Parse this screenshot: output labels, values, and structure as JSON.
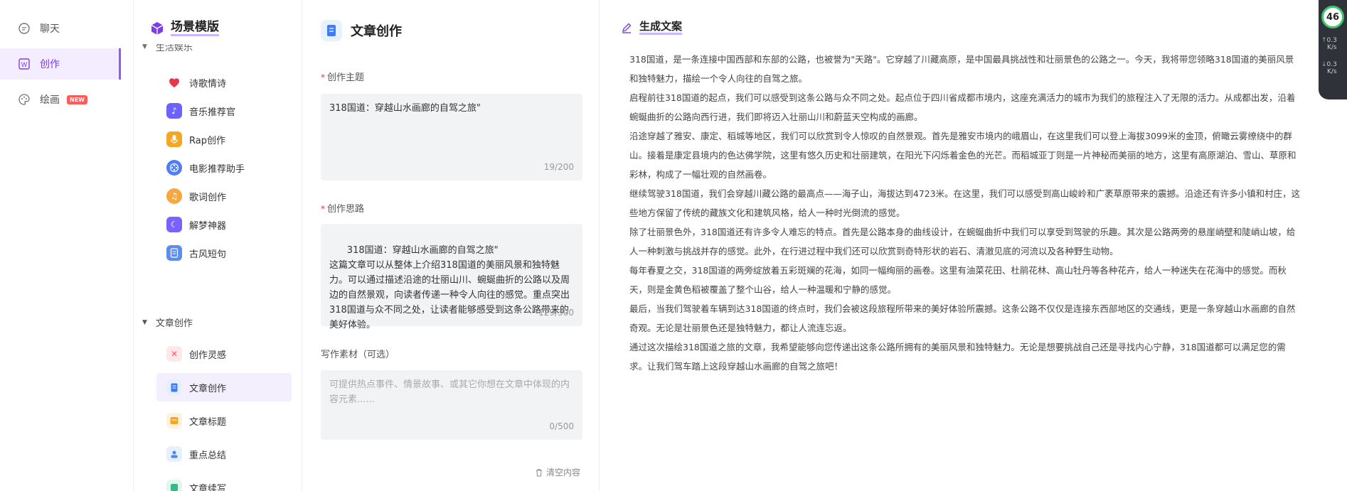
{
  "nav": {
    "items": [
      {
        "label": "聊天",
        "icon": "chat-bubble-icon"
      },
      {
        "label": "创作",
        "icon": "w-document-icon"
      },
      {
        "label": "绘画",
        "icon": "palette-icon",
        "badge": "NEW"
      }
    ]
  },
  "scenes": {
    "title": "场景模版",
    "partial_group": "生活娱乐",
    "group_article": "文章创作",
    "items_life": [
      {
        "label": "诗歌情诗",
        "icon": "heart-icon",
        "color": "#e8364a"
      },
      {
        "label": "音乐推荐官",
        "icon": "music-icon",
        "color": "#6c63ff"
      },
      {
        "label": "Rap创作",
        "icon": "microphone-icon",
        "color": "#f5a623"
      },
      {
        "label": "电影推荐助手",
        "icon": "film-reel-icon",
        "color": "#4f7df9"
      },
      {
        "label": "歌词创作",
        "icon": "note-icon",
        "color": "#f6a740"
      },
      {
        "label": "解梦神器",
        "icon": "moon-icon",
        "color": "#7b61ff"
      },
      {
        "label": "古风短句",
        "icon": "scroll-icon",
        "color": "#5b8def"
      }
    ],
    "items_article": [
      {
        "label": "创作灵感",
        "icon": "cross-spark-icon",
        "color": "#ff5b6a"
      },
      {
        "label": "文章创作",
        "icon": "document-icon",
        "color": "#3d7cff"
      },
      {
        "label": "文章标题",
        "icon": "title-card-icon",
        "color": "#f5a623"
      },
      {
        "label": "重点总结",
        "icon": "summary-icon",
        "color": "#4f86f7"
      },
      {
        "label": "文章续写",
        "icon": "continue-icon",
        "color": "#2ebd85"
      }
    ]
  },
  "form": {
    "title": "文章创作",
    "topic_label": "创作主题",
    "topic_value": "318国道：穿越山水画廊的自驾之旅\"",
    "topic_count": "19/200",
    "idea_label": "创作思路",
    "idea_value": "318国道：穿越山水画廊的自驾之旅\"\n这篇文章可以从整体上介绍318国道的美丽风景和独特魅力。可以通过描述沿途的壮丽山川、蜿蜒曲折的公路以及周边的自然景观，向读者传递一种令人向往的感觉。重点突出318国道与众不同之处，让读者能够感受到这条公路带来的美好体验。",
    "idea_count": "129/300",
    "material_label": "写作素材（可选）",
    "material_placeholder": "可提供热点事件、情景故事、或其它你想在文章中体现的内容元素......",
    "material_count": "0/500",
    "clear_label": "清空内容"
  },
  "output": {
    "title": "生成文案",
    "paragraphs": [
      "318国道，是一条连接中国西部和东部的公路，也被誉为\"天路\"。它穿越了川藏高原，是中国最具挑战性和壮丽景色的公路之一。今天，我将带您领略318国道的美丽风景和独特魅力，描绘一个令人向往的自驾之旅。",
      "启程前往318国道的起点，我们可以感受到这条公路与众不同之处。起点位于四川省成都市境内，这座充满活力的城市为我们的旅程注入了无限的活力。从成都出发，沿着蜿蜒曲折的公路向西行进，我们即将迈入壮丽山川和蔚蓝天空构成的画廊。",
      "沿途穿越了雅安、康定、稻城等地区，我们可以欣赏到令人惊叹的自然景观。首先是雅安市境内的峨眉山，在这里我们可以登上海拔3099米的金顶，俯瞰云雾缭绕中的群山。接着是康定县境内的色达佛学院，这里有悠久历史和壮丽建筑，在阳光下闪烁着金色的光芒。而稻城亚丁则是一片神秘而美丽的地方，这里有高原湖泊、雪山、草原和彩林，构成了一幅壮观的自然画卷。",
      "继续驾驶318国道，我们会穿越川藏公路的最高点——海子山，海拔达到4723米。在这里，我们可以感受到高山峻岭和广袤草原带来的震撼。沿途还有许多小镇和村庄，这些地方保留了传统的藏族文化和建筑风格，给人一种时光倒流的感觉。",
      "除了壮丽景色外，318国道还有许多令人难忘的特点。首先是公路本身的曲线设计，在蜿蜒曲折中我们可以享受到驾驶的乐趣。其次是公路两旁的悬崖峭壁和陡峭山坡，给人一种刺激与挑战并存的感觉。此外，在行进过程中我们还可以欣赏到奇特形状的岩石、清澈见底的河流以及各种野生动物。",
      "每年春夏之交，318国道的两旁绽放着五彩斑斓的花海，如同一幅绚丽的画卷。这里有油菜花田、杜鹃花林、高山牡丹等各种花卉，给人一种迷失在花海中的感觉。而秋天，则是金黄色稻被覆盖了整个山谷，给人一种温暖和宁静的感觉。",
      "最后，当我们驾驶着车辆到达318国道的终点时，我们会被这段旅程所带来的美好体验所震撼。这条公路不仅仅是连接东西部地区的交通线，更是一条穿越山水画廊的自然奇观。无论是壮丽景色还是独特魅力，都让人流连忘返。",
      "通过这次描绘318国道之旅的文章，我希望能够向您传递出这条公路所拥有的美丽风景和独特魅力。无论是想要挑战自己还是寻找内心宁静，318国道都可以满足您的需求。让我们驾车踏上这段穿越山水画廊的自驾之旅吧！"
    ]
  },
  "widget": {
    "percent": "46",
    "up_value": "0.3",
    "up_unit": "K/s",
    "down_value": "0.3",
    "down_unit": "K/s"
  }
}
